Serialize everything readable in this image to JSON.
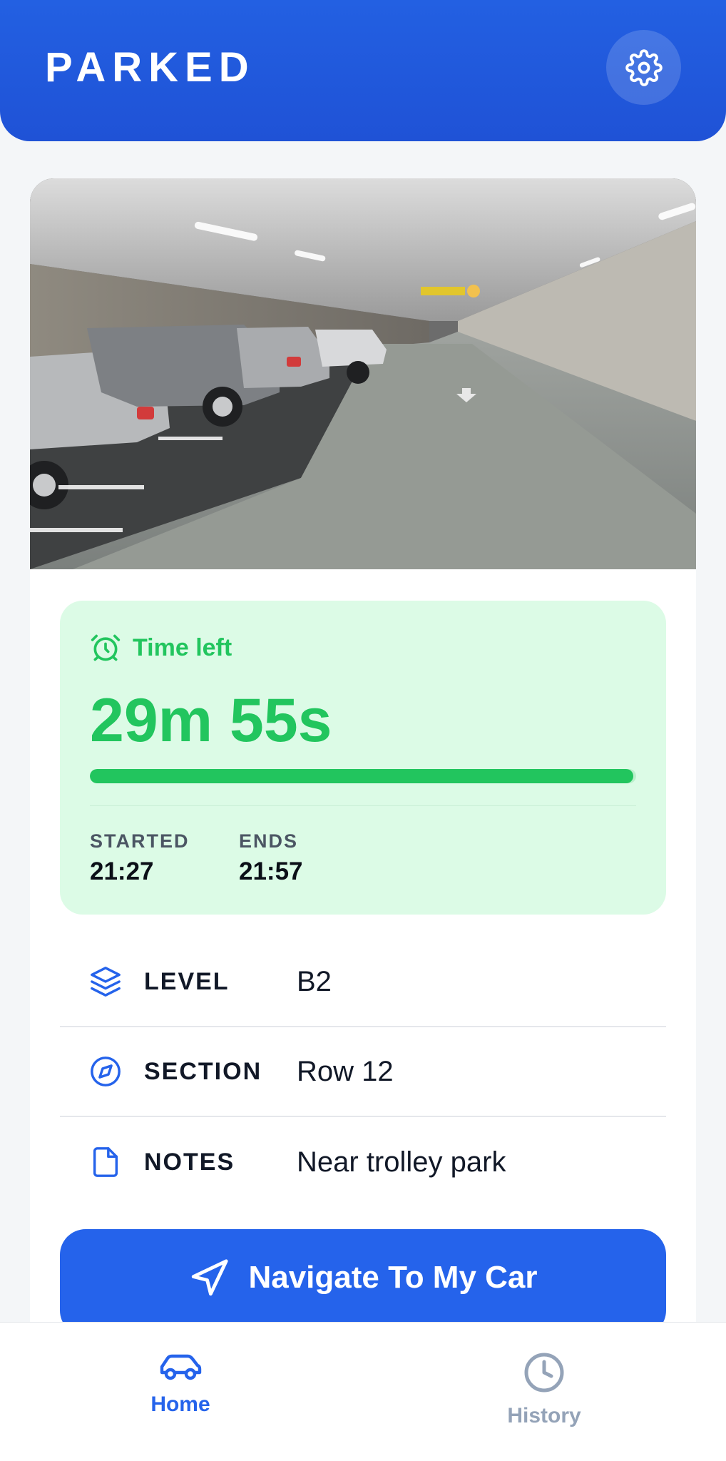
{
  "header": {
    "title": "PARKED",
    "settings_icon": "gear-icon"
  },
  "photo": {
    "description_icon": "parking-garage-photo"
  },
  "timer": {
    "label": "Time left",
    "value": "29m 55s",
    "progress": 0.995,
    "started_label": "STARTED",
    "started_value": "21:27",
    "ends_label": "ENDS",
    "ends_value": "21:57"
  },
  "details": {
    "level_label": "LEVEL",
    "level_value": "B2",
    "section_label": "SECTION",
    "section_value": "Row 12",
    "notes_label": "NOTES",
    "notes_value": "Near trolley park"
  },
  "navigate_button": {
    "label": "Navigate To My Car"
  },
  "tabbar": {
    "home_label": "Home",
    "history_label": "History"
  },
  "colors": {
    "primary": "#2563EB",
    "success": "#22C55E",
    "timer_bg": "#DCFBE6",
    "inactive": "#94A3B8"
  }
}
